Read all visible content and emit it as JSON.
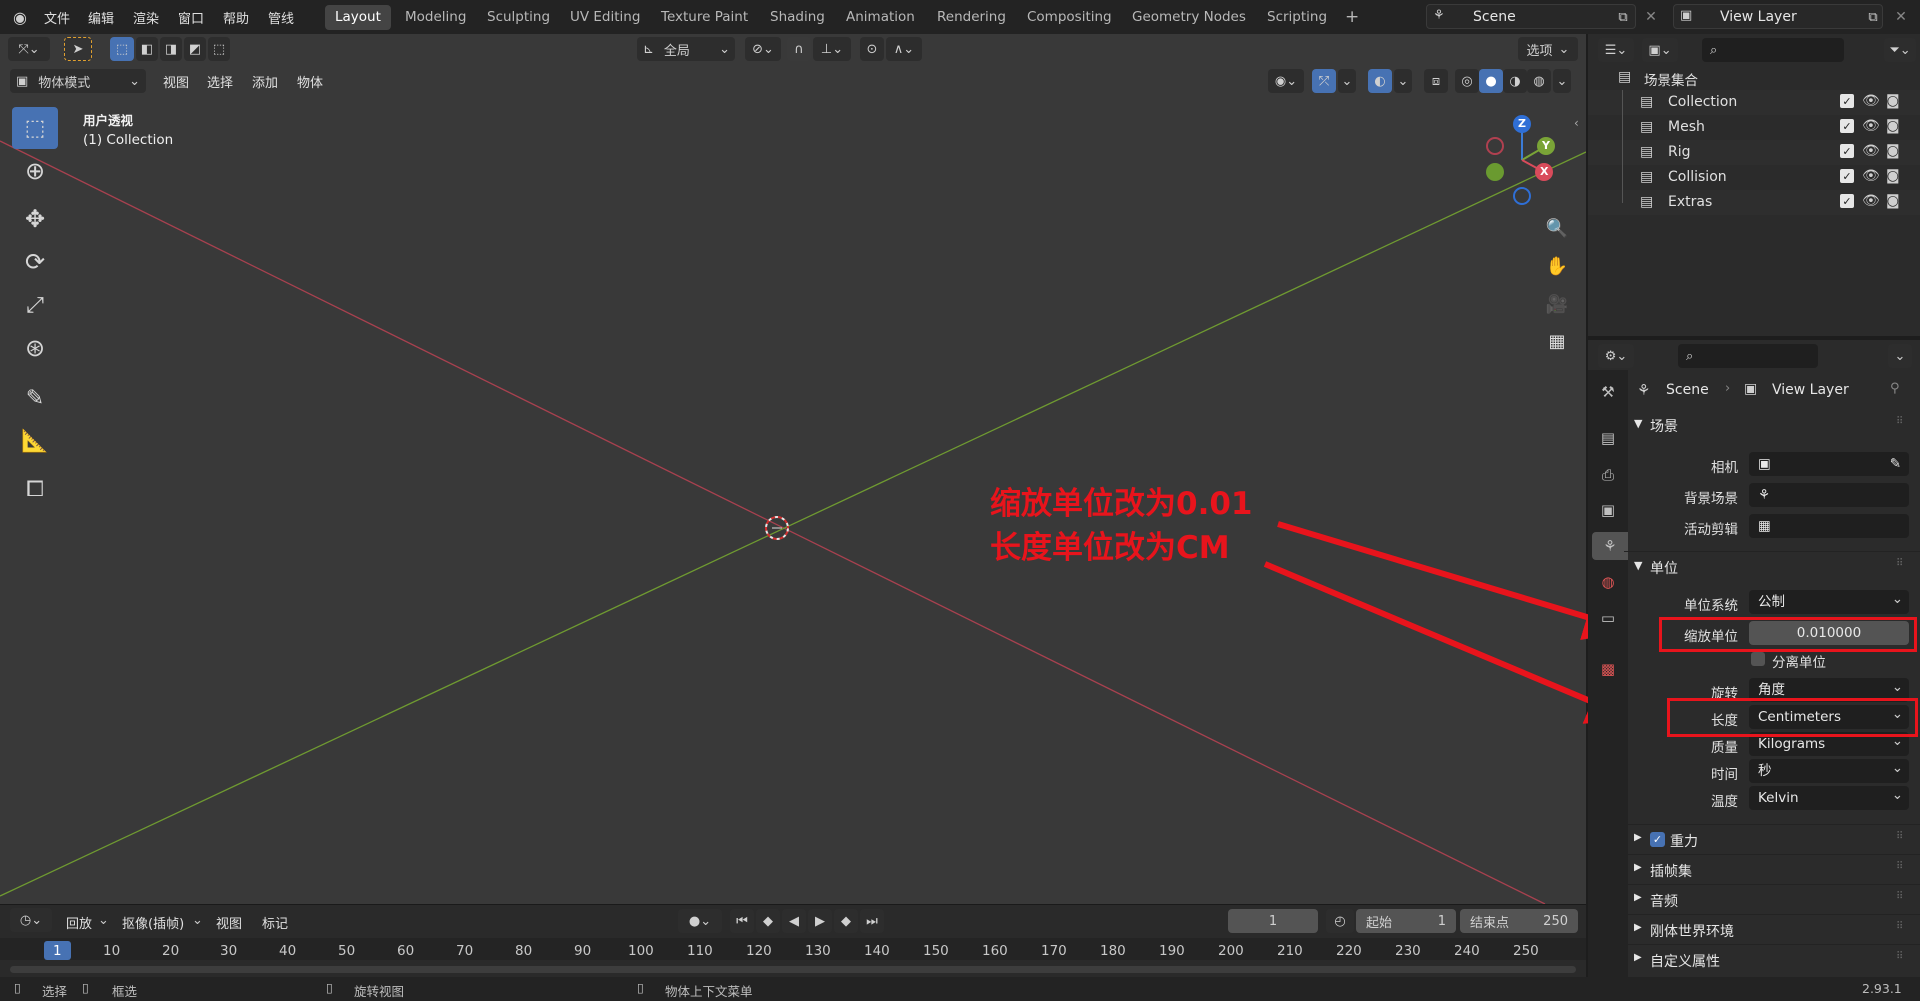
{
  "topbar": {
    "menus": [
      "文件",
      "编辑",
      "渲染",
      "窗口",
      "帮助",
      "管线"
    ],
    "workspaces": [
      "Layout",
      "Modeling",
      "Sculpting",
      "UV Editing",
      "Texture Paint",
      "Shading",
      "Animation",
      "Rendering",
      "Compositing",
      "Geometry Nodes",
      "Scripting"
    ],
    "active_workspace": "Layout",
    "add_tab": "+",
    "scene_name": "Scene",
    "view_layer_name": "View Layer"
  },
  "viewport": {
    "mode": "物体模式",
    "menu": [
      "视图",
      "选择",
      "添加",
      "物体"
    ],
    "transform_orientation": "全局",
    "options_label": "选项",
    "overlay_title": "用户透视",
    "overlay_collection": "(1) Collection",
    "gizmo": {
      "z": "Z",
      "y": "Y",
      "x": "X"
    },
    "axis_colors": {
      "x": "#c5415a",
      "y": "#7aa437"
    }
  },
  "annotation": {
    "line1": "缩放单位改为0.01",
    "line2": "长度单位改为CM",
    "color": "#e8141c"
  },
  "timeline": {
    "playback": "回放",
    "keying": "抠像(插帧)",
    "view": "视图",
    "marker": "标记",
    "current_frame": "1",
    "start_label": "起始",
    "start": "1",
    "end_label": "结束点",
    "end": "250",
    "ticks": [
      "1",
      "10",
      "20",
      "30",
      "40",
      "50",
      "60",
      "70",
      "80",
      "90",
      "100",
      "110",
      "120",
      "130",
      "140",
      "150",
      "160",
      "170",
      "180",
      "190",
      "200",
      "210",
      "220",
      "230",
      "240",
      "250"
    ]
  },
  "statusbar": {
    "select": "选择",
    "box_select": "框选",
    "rotate_view": "旋转视图",
    "context_menu": "物体上下文菜单",
    "version": "2.93.1"
  },
  "outliner": {
    "root": "场景集合",
    "collections": [
      "Collection",
      "Mesh",
      "Rig",
      "Collision",
      "Extras"
    ]
  },
  "properties": {
    "breadcrumb_scene": "Scene",
    "breadcrumb_view_layer": "View Layer",
    "scene_section": "场景",
    "camera_label": "相机",
    "background_label": "背景场景",
    "clip_label": "活动剪辑",
    "units_section": "单位",
    "unit_system_label": "单位系统",
    "unit_system": "公制",
    "unit_scale_label": "缩放单位",
    "unit_scale": "0.010000",
    "separate_units": "分离单位",
    "rotation_label": "旋转",
    "rotation": "角度",
    "length_label": "长度",
    "length": "Centimeters",
    "mass_label": "质量",
    "mass": "Kilograms",
    "time_label": "时间",
    "time": "秒",
    "temperature_label": "温度",
    "temperature": "Kelvin",
    "gravity": "重力",
    "keying_sets": "插帧集",
    "audio": "音频",
    "rigid_body_world": "刚体世界环境",
    "custom_props": "自定义属性"
  }
}
